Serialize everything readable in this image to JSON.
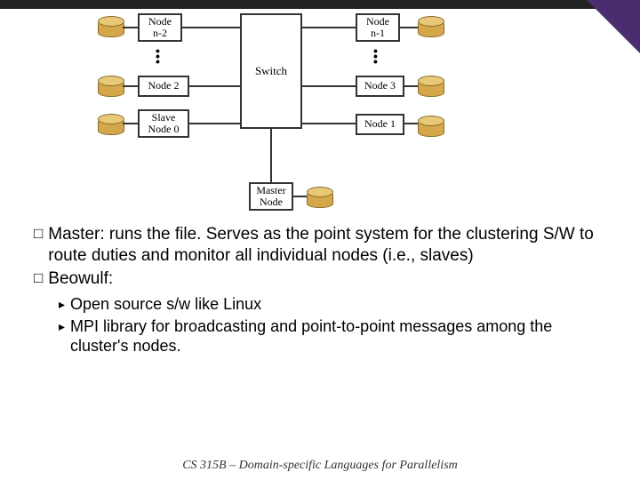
{
  "diagram": {
    "switch": "Switch",
    "master_node": "Master\nNode",
    "left": {
      "n2": "Node\nn-2",
      "node2": "Node 2",
      "slave0": "Slave\nNode 0"
    },
    "right": {
      "n1": "Node\nn-1",
      "node3": "Node 3",
      "node1": "Node 1"
    }
  },
  "bullets": {
    "master_label": "Master:",
    "master_body": " runs the file. Serves as the point system for the clustering S/W to route duties and monitor all individual nodes (i.e., slaves)",
    "beowulf_label": "Beowulf:",
    "sub1": "Open source s/w like Linux",
    "sub2": "MPI library for broadcasting and point-to-point messages among the cluster's nodes."
  },
  "footer": "CS 315B – Domain-specific Languages for Parallelism"
}
